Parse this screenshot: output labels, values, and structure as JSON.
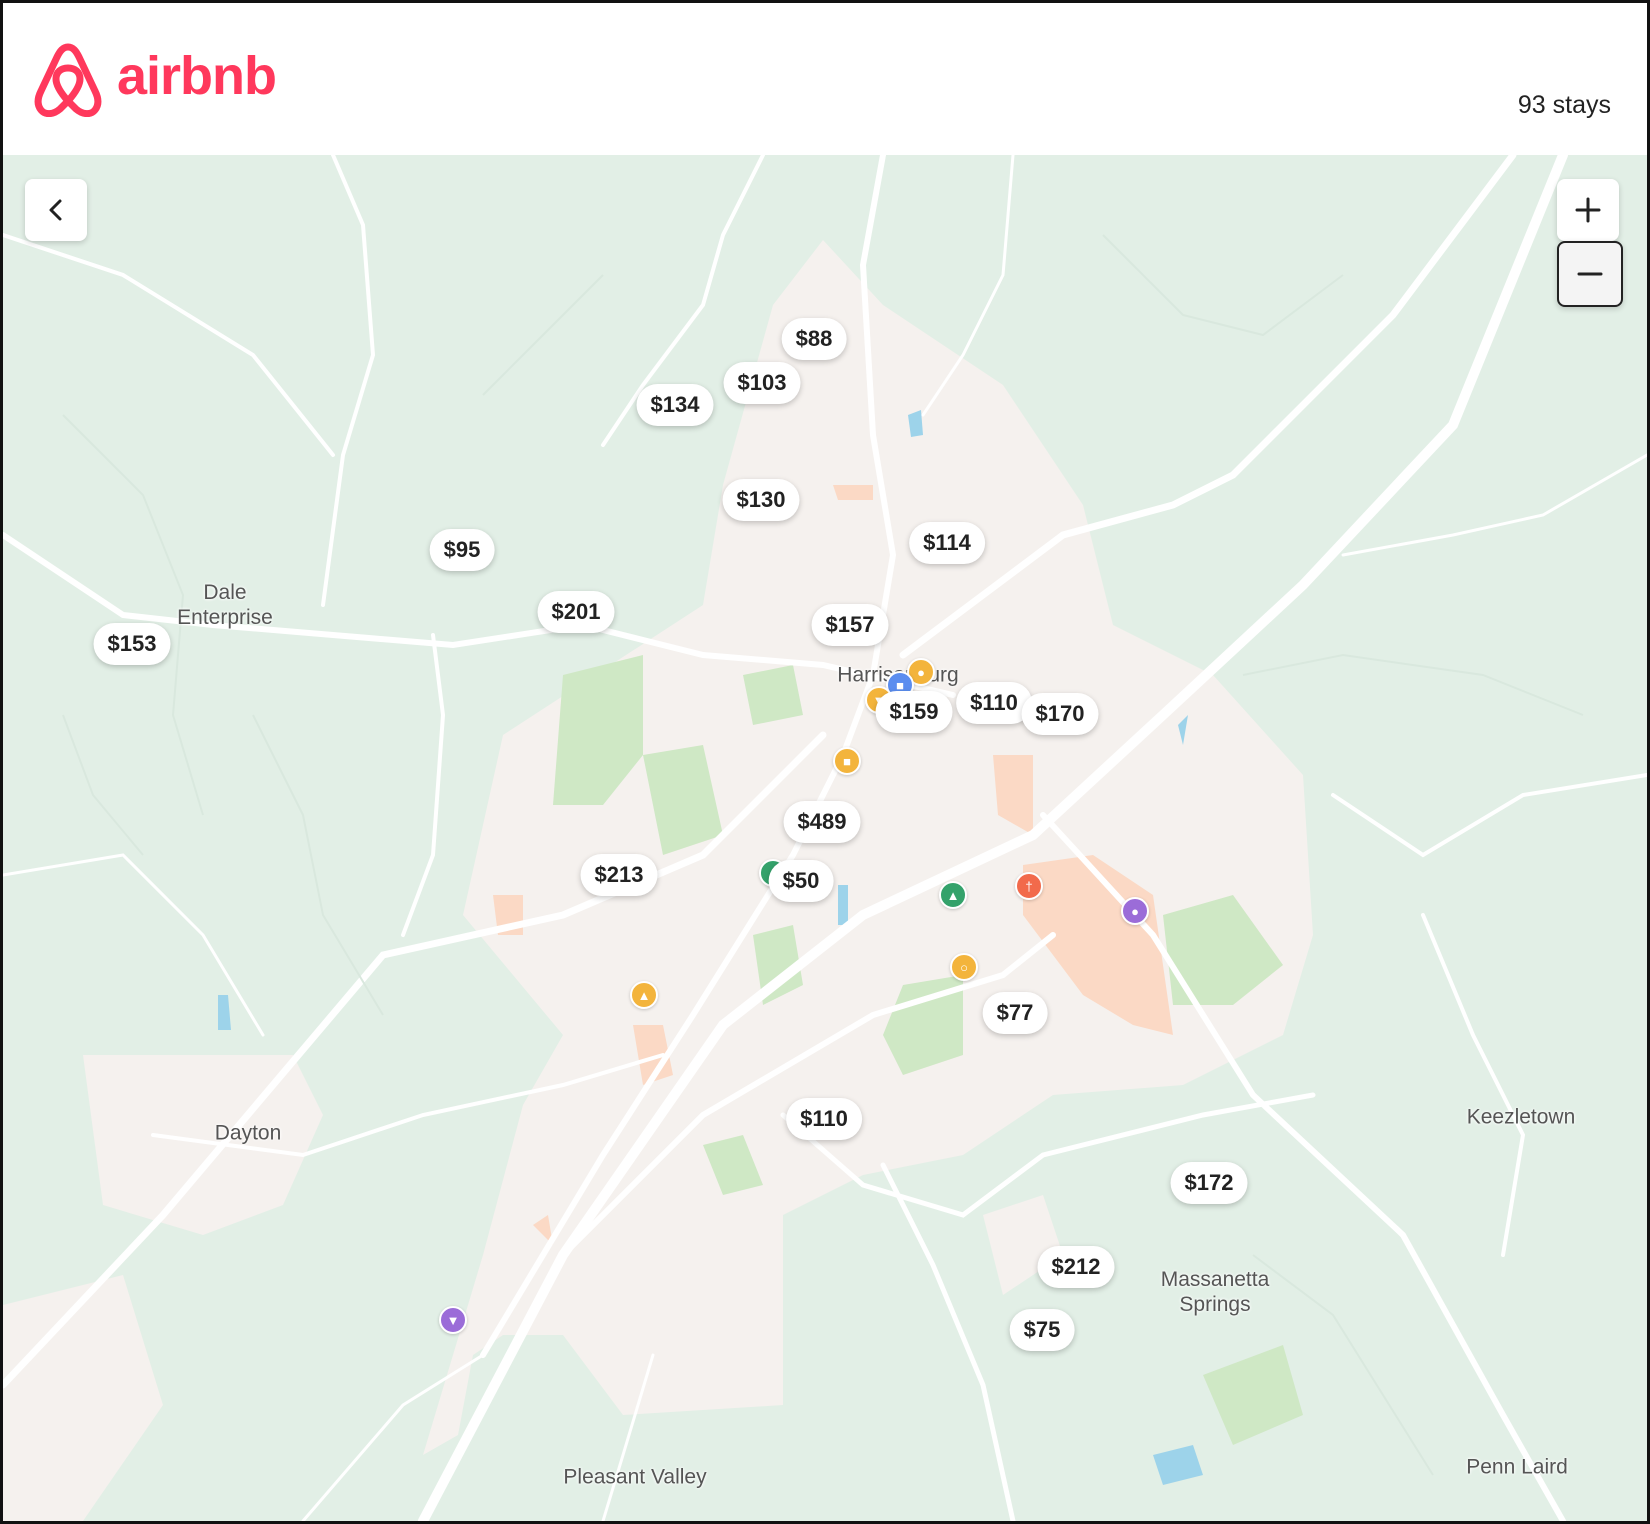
{
  "brand": {
    "name": "airbnb",
    "color": "#ff385c",
    "logo_icon": "airbnb-belo-icon"
  },
  "results": {
    "count_label": "93 stays"
  },
  "controls": {
    "back_icon": "chevron-left-icon",
    "zoom_in_icon": "plus-icon",
    "zoom_out_icon": "minus-icon"
  },
  "places": [
    "Dale\nEnterprise",
    "Harrisonburg",
    "Dayton",
    "Keezletown",
    "Massanetta\nSprings",
    "Pleasant Valley",
    "Penn Laird"
  ],
  "prices": [
    "$88",
    "$103",
    "$134",
    "$130",
    "$95",
    "$114",
    "$201",
    "$153",
    "$157",
    "$110",
    "$170",
    "$159",
    "$489",
    "$213",
    "$50",
    "$77",
    "$110",
    "$172",
    "$212",
    "$75"
  ],
  "pois": [
    {
      "icon": "shopping-bag-icon",
      "color": "#f3b43c"
    },
    {
      "icon": "museum-icon",
      "color": "#5b8def"
    },
    {
      "icon": "cocktail-icon",
      "color": "#f3b43c"
    },
    {
      "icon": "museum-icon",
      "color": "#f3b43c"
    },
    {
      "icon": "park-icon",
      "color": "#34a26b"
    },
    {
      "icon": "restaurant-icon",
      "color": "#f26a4b"
    },
    {
      "icon": "shopping-bag-icon",
      "color": "#9b6cd8"
    },
    {
      "icon": "landmark-icon",
      "color": "#f3b43c"
    },
    {
      "icon": "grocery-cart-icon",
      "color": "#f3b43c"
    },
    {
      "icon": "grocery-basket-icon",
      "color": "#9b6cd8"
    },
    {
      "icon": "park-icon",
      "color": "#34a26b"
    }
  ],
  "map_colors": {
    "terrain": "#e2efe6",
    "urban": "#f5f1ee",
    "park": "#cfe8c5",
    "commercial": "#fbd9c5",
    "water": "#9dd3ea",
    "road": "#ffffff"
  }
}
